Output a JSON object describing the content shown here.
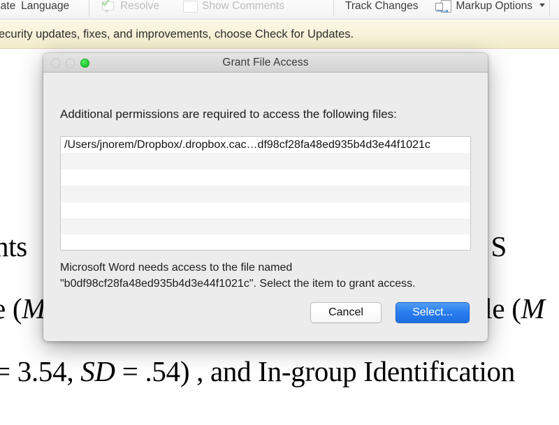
{
  "ribbon": {
    "items": [
      {
        "label": "islate",
        "icon": "translate-icon"
      },
      {
        "label": "Language",
        "icon": "language-icon"
      },
      {
        "label": "Resolve",
        "icon": "resolve-comment-icon"
      },
      {
        "label": "Show Comments",
        "icon": "show-comments-icon"
      },
      {
        "label": "Track Changes",
        "icon": "track-changes-icon"
      },
      {
        "label": "Markup Options",
        "icon": "markup-options-icon"
      }
    ],
    "markup_options_caret": "chevron-down-icon"
  },
  "notification": {
    "text": "ecurity updates, fixes, and improvements, choose Check for Updates."
  },
  "document": {
    "line1_pre": "nts",
    "line1_post": "Trust S",
    "line2_pre": "e (",
    "line2_pre_italic": "M",
    "line2_post": "Scale (",
    "line2_post_italic": "M",
    "line3_a": "= 3.54, ",
    "line3_italic": "SD",
    "line3_b": " = .54) , and In-group Identification"
  },
  "dialog": {
    "title": "Grant File Access",
    "traffic_lights": {
      "close": "close-button",
      "minimize": "minimize-button",
      "zoom": "zoom-button"
    },
    "prompt": "Additional permissions are required to access the following files:",
    "file_list": {
      "rows": [
        "/Users/jnorem/Dropbox/.dropbox.cac…df98cf28fa48ed935b4d3e44f1021c",
        "",
        "",
        "",
        "",
        "",
        ""
      ]
    },
    "explanation": "Microsoft Word needs access to the file named \"b0df98cf28fa48ed935b4d3e44f1021c\". Select the item to grant access.",
    "buttons": {
      "cancel": "Cancel",
      "select": "Select..."
    }
  },
  "colors": {
    "accent_blue": "#2a7df0",
    "notify_bar": "#f7f2d8",
    "dialog_bg": "#ececec",
    "zoom_green": "#25cf36"
  }
}
